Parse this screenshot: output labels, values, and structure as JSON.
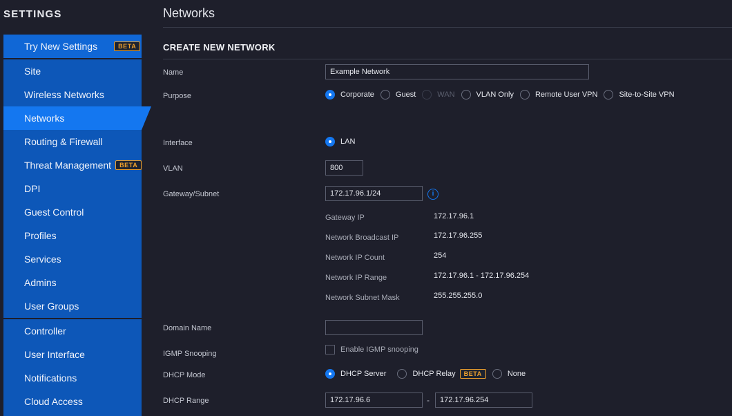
{
  "sidebar": {
    "title": "SETTINGS",
    "top": {
      "label": "Try New Settings",
      "badge": "BETA"
    },
    "items": [
      {
        "label": "Site"
      },
      {
        "label": "Wireless Networks"
      },
      {
        "label": "Networks",
        "active": true
      },
      {
        "label": "Routing & Firewall"
      },
      {
        "label": "Threat Management",
        "badge": "BETA"
      },
      {
        "label": "DPI"
      },
      {
        "label": "Guest Control"
      },
      {
        "label": "Profiles"
      },
      {
        "label": "Services"
      },
      {
        "label": "Admins"
      },
      {
        "label": "User Groups"
      }
    ],
    "bottom_items": [
      {
        "label": "Controller"
      },
      {
        "label": "User Interface"
      },
      {
        "label": "Notifications"
      },
      {
        "label": "Cloud Access"
      }
    ]
  },
  "page": {
    "title": "Networks"
  },
  "form": {
    "section_title": "CREATE NEW NETWORK",
    "name": {
      "label": "Name",
      "value": "Example Network"
    },
    "purpose": {
      "label": "Purpose",
      "options": [
        "Corporate",
        "Guest",
        "WAN",
        "VLAN Only",
        "Remote User VPN",
        "Site-to-Site VPN"
      ],
      "selected": "Corporate",
      "disabled": "WAN"
    },
    "interface": {
      "label": "Interface",
      "option": "LAN"
    },
    "vlan": {
      "label": "VLAN",
      "value": "800"
    },
    "gateway_subnet": {
      "label": "Gateway/Subnet",
      "value": "172.17.96.1/24",
      "info_icon": "i",
      "details": [
        {
          "label": "Gateway IP",
          "value": "172.17.96.1"
        },
        {
          "label": "Network Broadcast IP",
          "value": "172.17.96.255"
        },
        {
          "label": "Network IP Count",
          "value": "254"
        },
        {
          "label": "Network IP Range",
          "value": "172.17.96.1 - 172.17.96.254"
        },
        {
          "label": "Network Subnet Mask",
          "value": "255.255.255.0"
        }
      ]
    },
    "domain_name": {
      "label": "Domain Name",
      "value": ""
    },
    "igmp": {
      "label": "IGMP Snooping",
      "checkbox_label": "Enable IGMP snooping"
    },
    "dhcp_mode": {
      "label": "DHCP Mode",
      "options": [
        "DHCP Server",
        "DHCP Relay",
        "None"
      ],
      "relay_badge": "BETA",
      "selected": "DHCP Server"
    },
    "dhcp_range": {
      "label": "DHCP Range",
      "start": "172.17.96.6",
      "separator": "-",
      "end": "172.17.96.254"
    }
  },
  "colors": {
    "accent": "#1477f0",
    "sidebar": "#0d57b8",
    "background": "#1e1f2b",
    "badge": "#f0a12c"
  }
}
